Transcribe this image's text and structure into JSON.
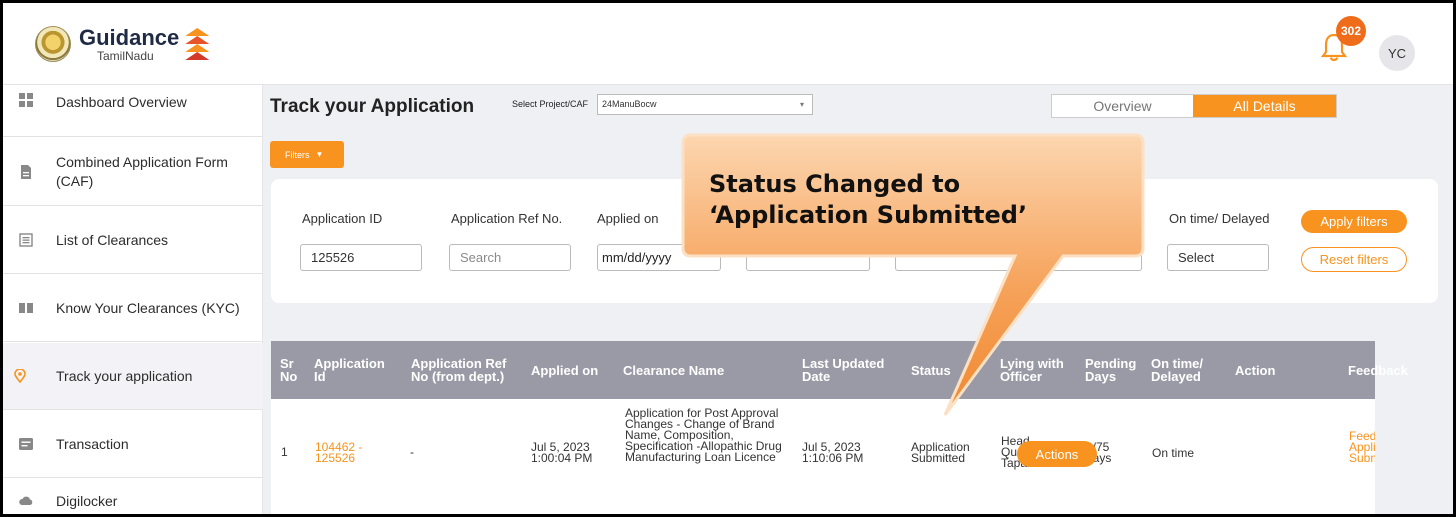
{
  "header": {
    "logo_title": "Guidance",
    "logo_subtitle": "TamilNadu",
    "notification_count": "302",
    "user_initials": "YC"
  },
  "sidebar": {
    "items": [
      {
        "label": "Dashboard Overview",
        "icon": "dashboard-icon"
      },
      {
        "label": "Combined Application Form (CAF)",
        "icon": "document-icon"
      },
      {
        "label": "List of Clearances",
        "icon": "list-icon"
      },
      {
        "label": "Know Your Clearances (KYC)",
        "icon": "book-icon"
      },
      {
        "label": "Track your application",
        "icon": "location-pin-icon",
        "active": true
      },
      {
        "label": "Transaction",
        "icon": "transaction-icon"
      },
      {
        "label": "Digilocker",
        "icon": "cloud-icon"
      }
    ]
  },
  "main": {
    "title": "Track your Application",
    "project_label": "Select Project/CAF",
    "project_value": "24ManuBocw",
    "tabs": {
      "overview": "Overview",
      "all_details": "All Details"
    },
    "filters_button": "Filters"
  },
  "filters": {
    "application_id": {
      "label": "Application ID",
      "value": "125526"
    },
    "application_ref": {
      "label": "Application Ref No.",
      "placeholder": "Search"
    },
    "applied_on": {
      "label": "Applied on",
      "placeholder": "mm/dd/yyyy"
    },
    "on_time_delayed": {
      "label": "On time/ Delayed",
      "value": "Select"
    },
    "apply_button": "Apply filters",
    "reset_button": "Reset filters"
  },
  "table": {
    "headers": [
      "Sr No",
      "Application Id",
      "Application Ref No (from dept.)",
      "Applied on",
      "Clearance Name",
      "Last Updated Date",
      "Status",
      "Lying with Officer",
      "Pending Days",
      "On time/ Delayed",
      "Action",
      "Feedback"
    ],
    "rows": [
      {
        "sr": "1",
        "app_id": "104462 - 125526",
        "ref": "-",
        "applied_on": "Jul 5, 2023 1:00:04 PM",
        "clearance": "Application for Post Approval Changes - Change of Brand Name, Composition, Specification -Allopathic Drug Manufacturing Loan Licence",
        "last_updated": "Jul 5, 2023 1:10:06 PM",
        "status": "Application Submitted",
        "officer": "Head Quarters Tapal",
        "pending": "0/75 days",
        "on_time": "On time",
        "action": "Actions",
        "feedback": "Feedback Application Submitted"
      }
    ]
  },
  "callout": {
    "text": "Status Changed to\n‘Application Submitted’"
  },
  "colors": {
    "accent": "#f7931e",
    "badge": "#ef6c1a",
    "table_header": "#9a9aa6"
  }
}
